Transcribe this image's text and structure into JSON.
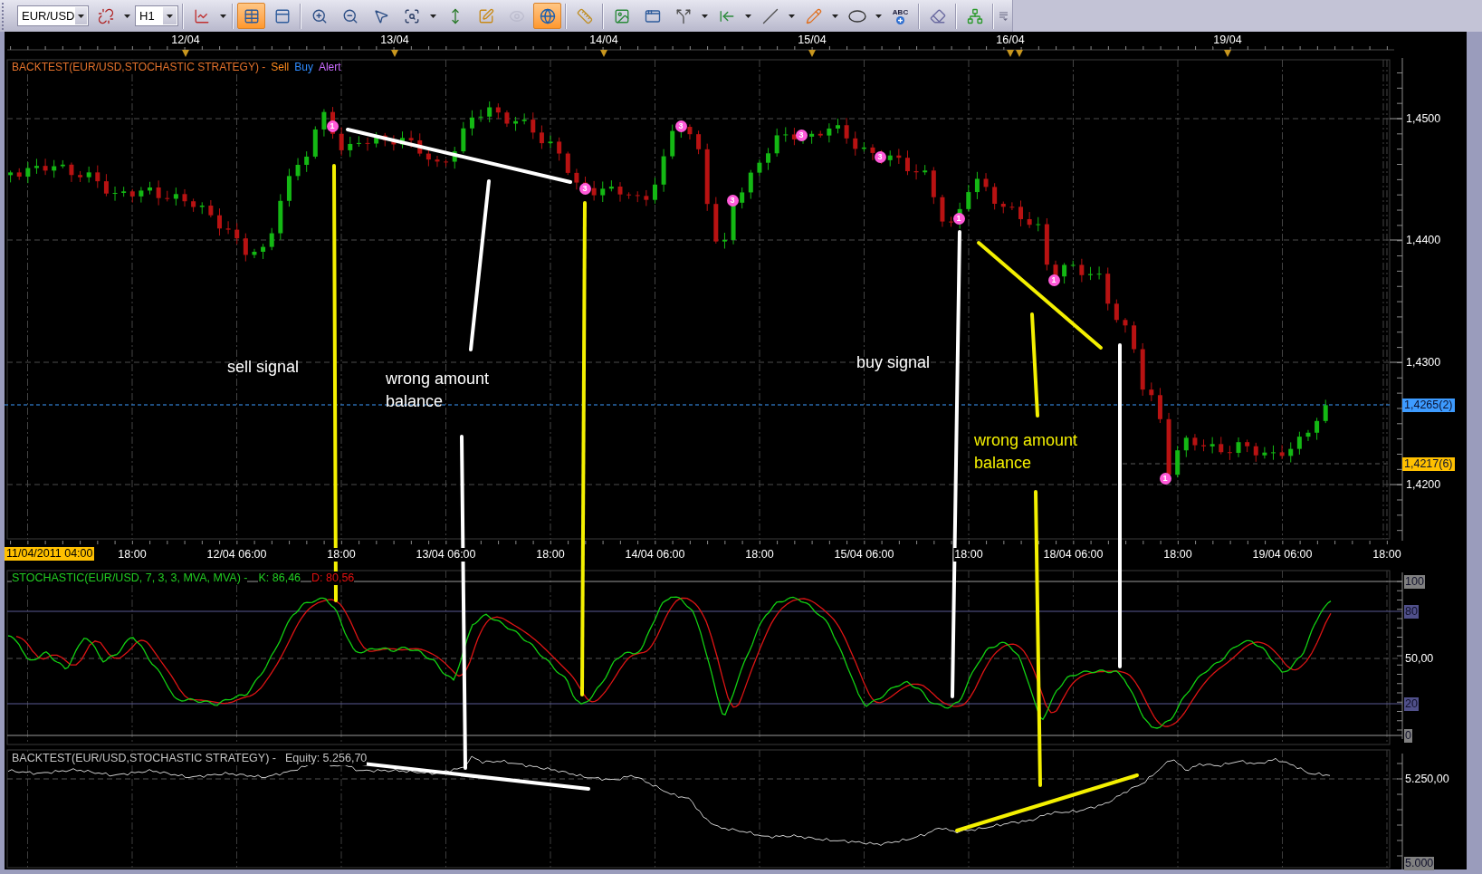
{
  "toolbar": {
    "groups": [
      {
        "items": [
          {
            "kind": "combo",
            "value": "EUR/USD"
          },
          {
            "kind": "button",
            "on": false,
            "disabled": false,
            "dropdown": true
          },
          {
            "kind": "combo",
            "value": "H1"
          }
        ]
      },
      {
        "items": [
          {
            "kind": "button",
            "on": false,
            "disabled": false,
            "dropdown": true
          }
        ]
      },
      {
        "items": [
          {
            "kind": "button",
            "on": true,
            "disabled": false,
            "dropdown": false
          },
          {
            "kind": "button",
            "on": false,
            "disabled": false,
            "dropdown": false
          }
        ]
      },
      {
        "items": [
          {
            "kind": "button",
            "on": false,
            "disabled": false,
            "dropdown": false
          },
          {
            "kind": "button",
            "on": false,
            "disabled": false,
            "dropdown": false
          },
          {
            "kind": "button",
            "on": false,
            "disabled": false,
            "dropdown": false
          },
          {
            "kind": "button",
            "on": false,
            "disabled": false,
            "dropdown": true
          },
          {
            "kind": "button",
            "on": false,
            "disabled": false,
            "dropdown": false
          },
          {
            "kind": "button",
            "on": false,
            "disabled": false,
            "dropdown": false
          },
          {
            "kind": "button",
            "on": false,
            "disabled": true,
            "dropdown": false
          },
          {
            "kind": "button",
            "on": true,
            "disabled": false,
            "dropdown": false
          }
        ]
      },
      {
        "items": [
          {
            "kind": "button",
            "on": false,
            "disabled": false,
            "dropdown": false
          }
        ]
      },
      {
        "items": [
          {
            "kind": "button",
            "on": false,
            "disabled": false,
            "dropdown": false
          },
          {
            "kind": "button",
            "on": false,
            "disabled": false,
            "dropdown": false
          },
          {
            "kind": "button",
            "on": false,
            "disabled": false,
            "dropdown": true
          },
          {
            "kind": "button",
            "on": false,
            "disabled": false,
            "dropdown": true
          },
          {
            "kind": "button",
            "on": false,
            "disabled": false,
            "dropdown": true
          },
          {
            "kind": "button",
            "on": false,
            "disabled": false,
            "dropdown": true
          },
          {
            "kind": "button",
            "on": false,
            "disabled": false,
            "dropdown": true
          },
          {
            "kind": "button",
            "on": false,
            "disabled": false,
            "dropdown": false,
            "label": "ABC"
          }
        ]
      },
      {
        "items": [
          {
            "kind": "button",
            "on": false,
            "disabled": false,
            "dropdown": false
          }
        ]
      },
      {
        "items": [
          {
            "kind": "button",
            "on": false,
            "disabled": false,
            "dropdown": false
          }
        ]
      }
    ]
  },
  "chart": {
    "date_axis": {
      "labels": [
        "12/04",
        "13/04",
        "14/04",
        "15/04",
        "16/04",
        "19/04"
      ]
    },
    "price_panel": {
      "title": "BACKTEST(EUR/USD,STOCHASTIC STRATEGY) -",
      "legend": [
        {
          "label": "Sell",
          "color": "#ff8a1c"
        },
        {
          "label": "Buy",
          "color": "#2f8cff"
        },
        {
          "label": "Alert",
          "color": "#cc6cff"
        }
      ],
      "price_labels": [
        "1,4500",
        "1,4400",
        "1,4300",
        "1,4200"
      ],
      "price_tags": [
        {
          "label": "1,4265(2)",
          "color": "#3d9bff"
        },
        {
          "label": "1,4217(6)",
          "color": "#ffc000"
        }
      ],
      "signal_markers": [
        {
          "label": "1"
        },
        {
          "label": "3"
        },
        {
          "label": "3"
        },
        {
          "label": "3"
        },
        {
          "label": "3"
        },
        {
          "label": "3"
        },
        {
          "label": "1"
        },
        {
          "label": "1"
        },
        {
          "label": "1"
        }
      ]
    },
    "time_axis": {
      "start_label": "11/04/2011 04:00",
      "labels": [
        "18:00",
        "12/04 06:00",
        "18:00",
        "13/04 06:00",
        "18:00",
        "14/04 06:00",
        "18:00",
        "15/04 06:00",
        "18:00",
        "18/04 06:00",
        "18:00",
        "19/04 06:00",
        "18:00"
      ]
    },
    "stochastic_panel": {
      "title": "STOCHASTIC(EUR/USD, 7, 3, 3, MVA, MVA) -",
      "k_reading": "K: 86,46",
      "d_reading": "D: 80,56",
      "levels": [
        {
          "label": "100",
          "color": "#808080"
        },
        {
          "label": "80",
          "color": "#50508a"
        },
        {
          "label": "50,00"
        },
        {
          "label": "20",
          "color": "#50508a"
        },
        {
          "label": "0",
          "color": "#808080"
        }
      ]
    },
    "equity_panel": {
      "title": "BACKTEST(EUR/USD,STOCHASTIC STRATEGY) -",
      "equity_reading": "Equity: 5.256,70",
      "levels": [
        {
          "label": "5.250,00"
        },
        {
          "label": "5.000",
          "color": "#808080"
        }
      ]
    }
  },
  "annotations": [
    {
      "text": "sell signal",
      "color": "#ffffff"
    },
    {
      "text": "wrong amount balance",
      "color": "#ffffff"
    },
    {
      "text": "buy signal",
      "color": "#ffffff"
    },
    {
      "text": "wrong amount balance",
      "color": "#f4f000"
    }
  ]
}
